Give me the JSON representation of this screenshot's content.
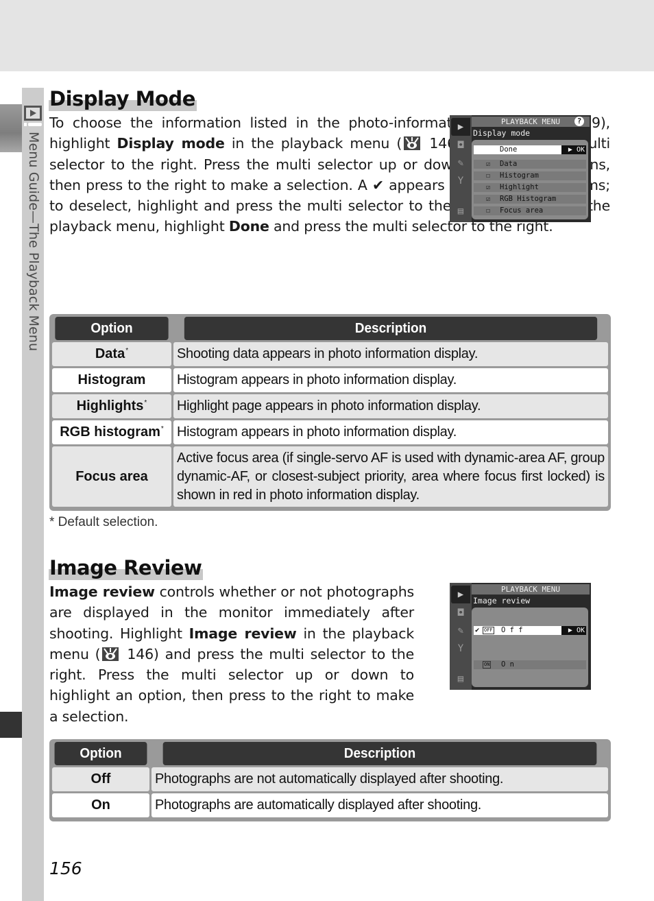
{
  "sidebar": {
    "label": "Menu Guide—The Playback Menu",
    "icon": "playback-icon"
  },
  "display_mode": {
    "title": "Display Mode",
    "paragraph": [
      {
        "t": "To choose the information listed in the photo-information display ("
      },
      {
        "icon": "reference-icon"
      },
      {
        "t": " 129), highlight "
      },
      {
        "b": "Display mode"
      },
      {
        "t": " in the playback menu ("
      },
      {
        "icon": "reference-icon"
      },
      {
        "t": " 146) and press the multi selector to the right.  Press the multi selector up or down to highlight options, then press to the right to make a selection.  A ✔ appears next to selected items; to deselect, highlight and press the multi selector to the right.  To return to the playback menu, highlight "
      },
      {
        "b": "Done"
      },
      {
        "t": " and press the multi selector to the right."
      }
    ],
    "screen": {
      "header": "PLAYBACK MENU",
      "help": "?",
      "subheader": "Display mode",
      "ok_label": "▶ OK",
      "rows": [
        {
          "label": "Done",
          "box": "",
          "selected": true
        },
        {
          "label": "Data",
          "box": "☑",
          "selected": false
        },
        {
          "label": "Histogram",
          "box": "☐",
          "selected": false
        },
        {
          "label": "Highlight",
          "box": "☑",
          "selected": false
        },
        {
          "label": "RGB Histogram",
          "box": "☑",
          "selected": false
        },
        {
          "label": "Focus area",
          "box": "☐",
          "selected": false
        }
      ]
    },
    "table": {
      "headers": [
        "Option",
        "Description"
      ],
      "rows": [
        {
          "option": "Data",
          "default": "*",
          "description": "Shooting data appears in photo information display."
        },
        {
          "option": "Histogram",
          "default": "",
          "description": "Histogram appears in photo information display."
        },
        {
          "option": "Highlights",
          "default": "*",
          "description": "Highlight page appears in photo information display."
        },
        {
          "option": "RGB histogram",
          "default": "*",
          "description": "Histogram appears in photo information display."
        },
        {
          "option": "Focus area",
          "default": "",
          "description": "Active focus area (if single-servo AF is used with dynamic-area AF, group dynamic-AF, or closest-subject priority, area where focus first locked) is shown in red in photo information display."
        }
      ]
    },
    "footnote": "* Default selection."
  },
  "image_review": {
    "title": "Image Review",
    "paragraph": [
      {
        "b": "Image review"
      },
      {
        "t": " controls whether or not photographs are displayed in the monitor immediately after shooting.  Highlight "
      },
      {
        "b": "Image review"
      },
      {
        "t": " in the playback menu ("
      },
      {
        "icon": "reference-icon"
      },
      {
        "t": " 146) and press the multi selector to the right.  Press the multi selector up or down to highlight an option, then press to the right to make a selection."
      }
    ],
    "screen": {
      "header": "PLAYBACK MENU",
      "subheader": "Image review",
      "ok_label": "▶ OK",
      "rows": [
        {
          "label": "O f f",
          "badge": "OFF",
          "check": "✔",
          "selected": true
        },
        {
          "label": "O n",
          "badge": "ON",
          "check": "",
          "selected": false
        }
      ]
    },
    "table": {
      "headers": [
        "Option",
        "Description"
      ],
      "rows": [
        {
          "option": "Off",
          "default": "",
          "description": "Photographs are not automatically displayed after shooting."
        },
        {
          "option": "On",
          "default": "",
          "description": "Photographs are automatically displayed after shooting."
        }
      ]
    }
  },
  "page_number": "156"
}
